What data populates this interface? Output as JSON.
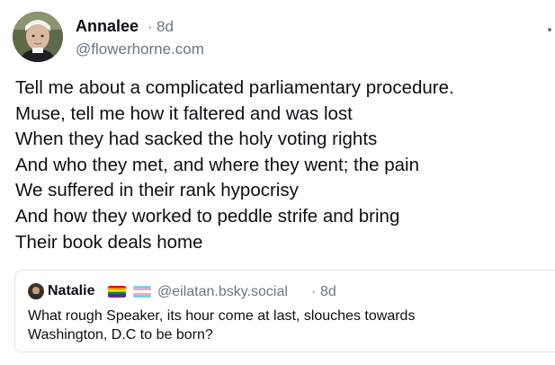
{
  "post": {
    "author": {
      "display_name": "Annalee",
      "handle": "@flowerhorne.com",
      "avatar_icon": "user-avatar"
    },
    "separator": "·",
    "age": "8d",
    "text_lines": [
      "Tell me about a complicated parliamentary procedure.",
      "Muse, tell me how it faltered and was lost",
      "When they had sacked the holy voting rights",
      "And who they met, and where they went; the pain",
      "We suffered in their rank hypocrisy",
      "And how they worked to peddle strife and bring",
      "Their book deals home"
    ],
    "menu_icon": "more-options-icon"
  },
  "quote": {
    "author": {
      "display_name": "Natalie",
      "badges": [
        "rainbow-flag",
        "transgender-flag"
      ],
      "handle": "@eilatan.bsky.social",
      "avatar_icon": "user-avatar"
    },
    "separator": "·",
    "age": "8d",
    "text_lines": [
      "What rough Speaker, its hour come at last, slouches towards",
      "Washington, D.C to be born?"
    ]
  },
  "colors": {
    "text_primary": "#0b0f14",
    "text_secondary": "#6b7682",
    "border": "#dde3ea"
  }
}
